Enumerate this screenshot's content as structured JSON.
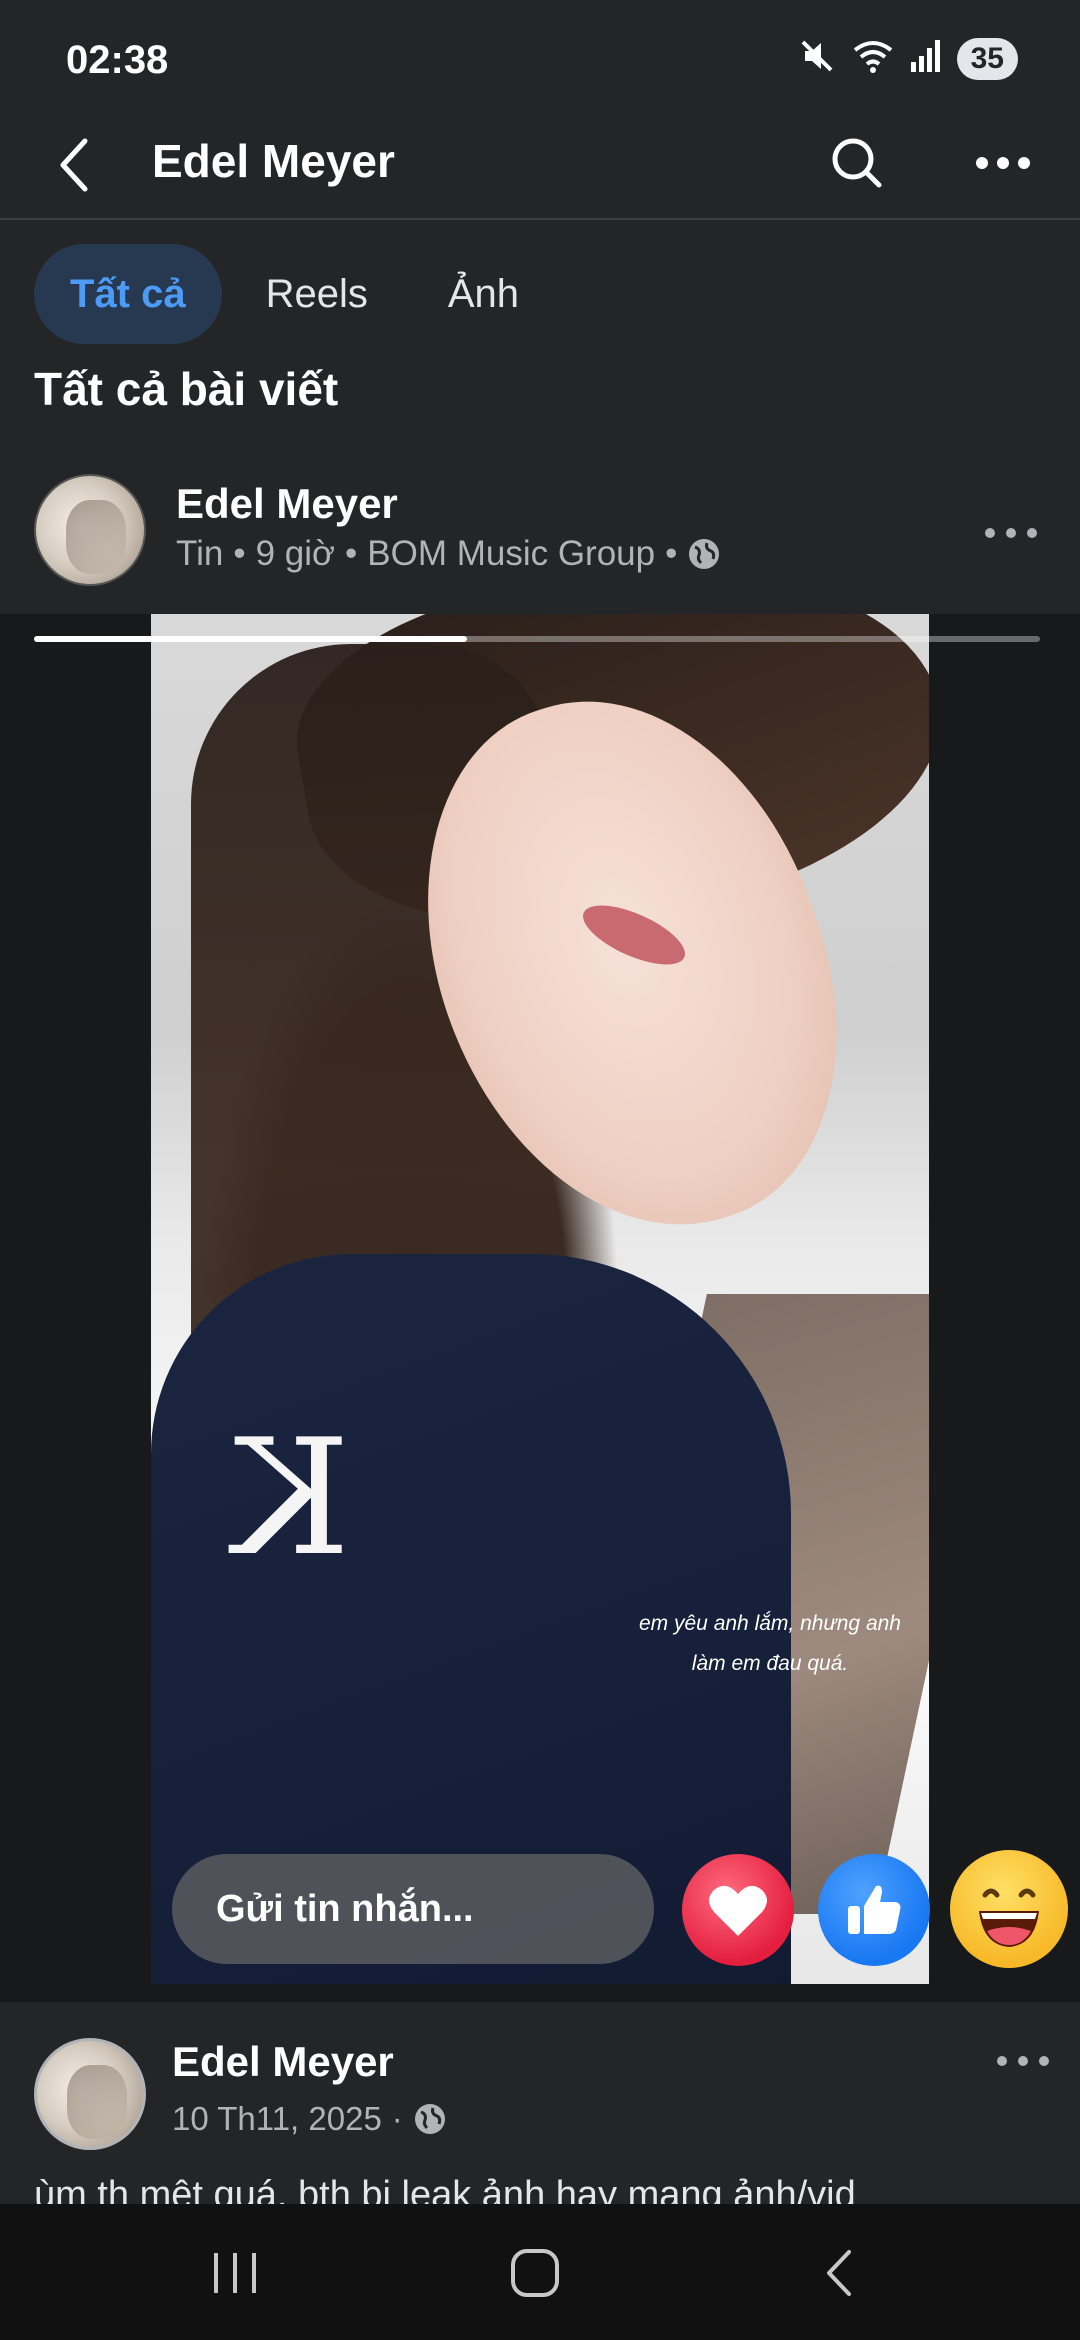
{
  "status_bar": {
    "time": "02:38",
    "battery": "35",
    "icons": [
      "mute-icon",
      "wifi-icon",
      "signal-icon"
    ]
  },
  "header": {
    "title": "Edel Meyer",
    "icons": [
      "back-icon",
      "search-icon",
      "more-icon"
    ]
  },
  "tabs": [
    {
      "label": "Tất cả",
      "active": true
    },
    {
      "label": "Reels",
      "active": false
    },
    {
      "label": "Ảnh",
      "active": false
    }
  ],
  "section_title": "Tất cả bài viết",
  "post1": {
    "author": "Edel Meyer",
    "meta_type": "Tin",
    "meta_time": "9 giờ",
    "meta_group": "BOM Music Group",
    "story": {
      "caption_line1": "em yêu anh lắm, nhưng anh",
      "caption_line2": "làm em đau quá.",
      "message_placeholder": "Gửi tin nhắn...",
      "progress_fraction": 0.43,
      "reactions": [
        "love-reaction",
        "like-reaction",
        "haha-reaction"
      ]
    }
  },
  "post2": {
    "author": "Edel Meyer",
    "date": "10 Th11, 2025",
    "text": "ùm th mệt quá, bth bị leak ảnh hay mang ảnh/vid"
  },
  "colors": {
    "background": "#242526",
    "active_tab_bg": "#263951",
    "active_tab_text": "#4d9bf6",
    "love": "#e41e3f",
    "like": "#1877f2",
    "haha": "#f7b928"
  }
}
